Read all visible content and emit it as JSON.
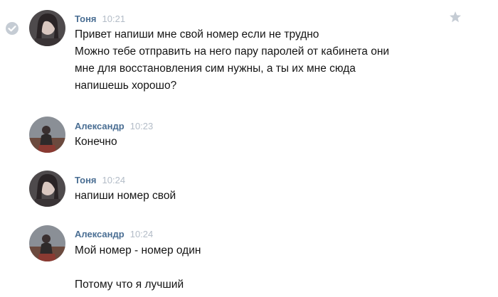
{
  "messages": [
    {
      "author": "Тоня",
      "time": "10:21",
      "lines": [
        "Привет напиши мне свой номер если не трудно",
        "Можно тебе отправить на него пару паролей от кабинета они",
        "мне для восстановления сим нужны, а ты их мне сюда",
        "напишешь хорошо?"
      ]
    },
    {
      "author": "Александр",
      "time": "10:23",
      "lines": [
        "Конечно"
      ]
    },
    {
      "author": "Тоня",
      "time": "10:24",
      "lines": [
        "напиши номер свой"
      ]
    },
    {
      "author": "Александр",
      "time": "10:24",
      "lines": [
        "Мой номер - номер один",
        "",
        "Потому что я лучший"
      ]
    }
  ],
  "icons": {
    "selected": "check-circle-icon",
    "favorite": "star-icon"
  },
  "colors": {
    "author": "#4a6e93",
    "time": "#b3bcc7",
    "text": "#141414",
    "icon_gray": "#c5ccd4"
  }
}
